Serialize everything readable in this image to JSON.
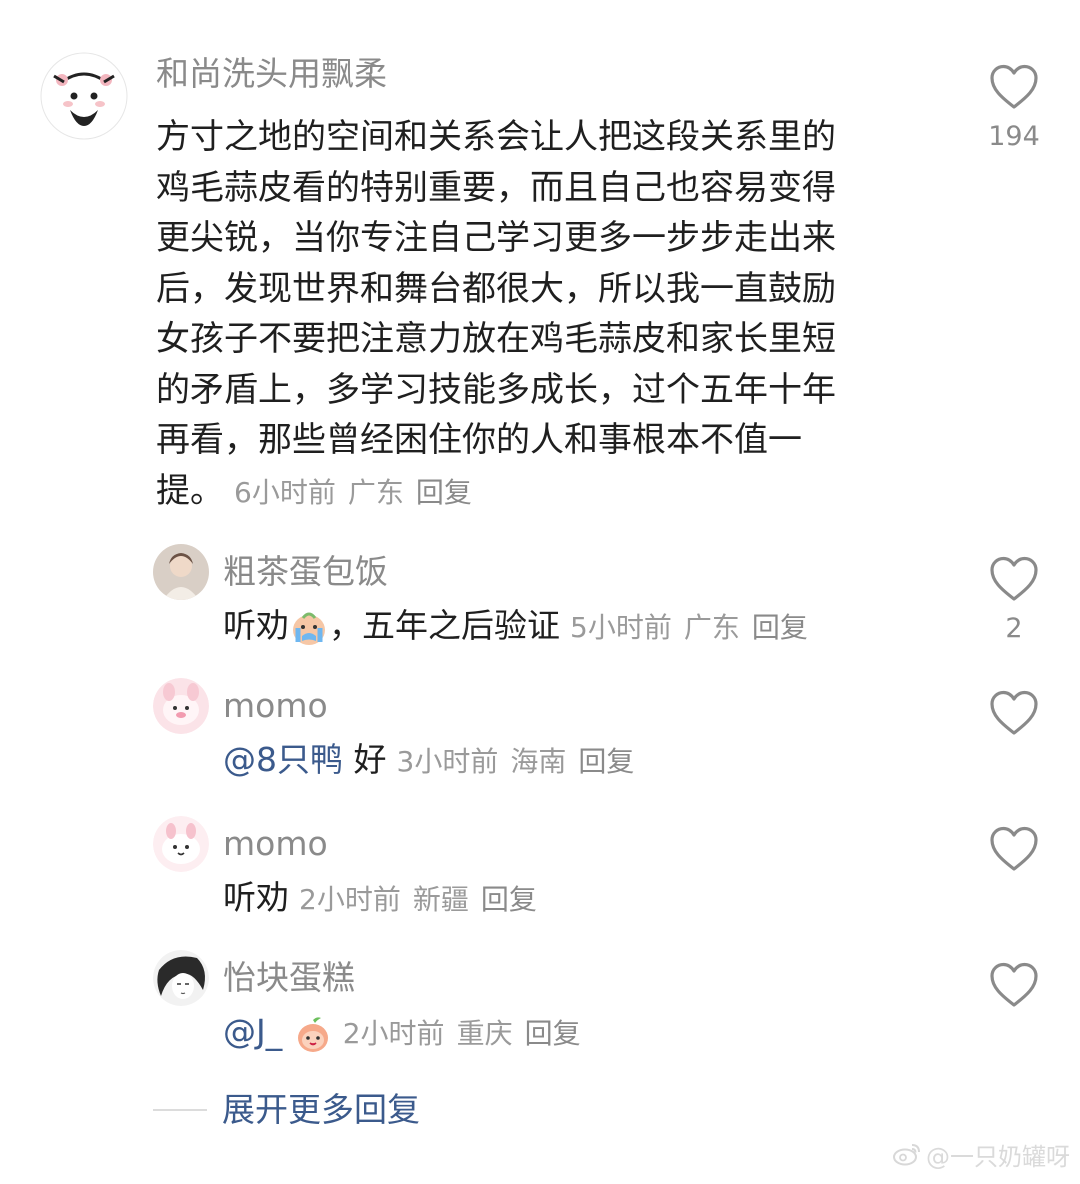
{
  "main_comment": {
    "username": "和尚洗头用飘柔",
    "lines": [
      "方寸之地的空间和关系会让人把这段关系里的",
      "鸡毛蒜皮看的特别重要，而且自己也容易变得",
      "更尖锐，当你专注自己学习更多一步步走出来",
      "后，发现世界和舞台都很大，所以我一直鼓励",
      "女孩子不要把注意力放在鸡毛蒜皮和家长里短",
      "的矛盾上，多学习技能多成长，过个五年十年",
      "再看，那些曾经困住你的人和事根本不值一",
      "提。"
    ],
    "time": "6小时前",
    "location": "广东",
    "reply_label": "回复",
    "likes": "194",
    "avatar_icon": "cartoon-face-avatar"
  },
  "replies": [
    {
      "username": "粗茶蛋包饭",
      "text_before": "听劝",
      "emoji": "crying-face-emoji",
      "text_after": "，五年之后验证",
      "time": "5小时前",
      "location": "广东",
      "reply_label": "回复",
      "likes": "2"
    },
    {
      "username": "momo",
      "mention": "@8只鸭",
      "text": "好",
      "time": "3小时前",
      "location": "海南",
      "reply_label": "回复",
      "likes": ""
    },
    {
      "username": "momo",
      "text": "听劝",
      "time": "2小时前",
      "location": "新疆",
      "reply_label": "回复",
      "likes": ""
    },
    {
      "username": "怡块蛋糕",
      "mention": "@J_",
      "emoji": "peach-face-emoji",
      "time": "2小时前",
      "location": "重庆",
      "reply_label": "回复",
      "likes": ""
    }
  ],
  "expand_label": "展开更多回复",
  "watermark": "@一只奶罐呀",
  "colors": {
    "username": "#8a8a8a",
    "body_text": "#1f1f1f",
    "mention": "#3b5a8c",
    "meta": "#9a9a9a",
    "heart_outline": "#8a8a8a"
  }
}
